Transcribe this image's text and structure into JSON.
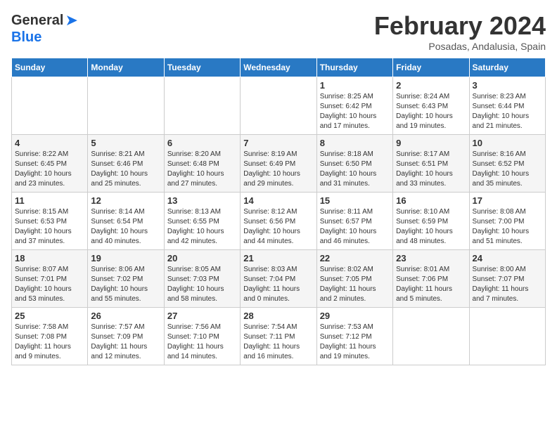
{
  "logo": {
    "general": "General",
    "blue": "Blue"
  },
  "title": "February 2024",
  "location": "Posadas, Andalusia, Spain",
  "days_of_week": [
    "Sunday",
    "Monday",
    "Tuesday",
    "Wednesday",
    "Thursday",
    "Friday",
    "Saturday"
  ],
  "weeks": [
    {
      "row_class": "",
      "days": [
        {
          "num": "",
          "info": ""
        },
        {
          "num": "",
          "info": ""
        },
        {
          "num": "",
          "info": ""
        },
        {
          "num": "",
          "info": ""
        },
        {
          "num": "1",
          "info": "Sunrise: 8:25 AM\nSunset: 6:42 PM\nDaylight: 10 hours\nand 17 minutes."
        },
        {
          "num": "2",
          "info": "Sunrise: 8:24 AM\nSunset: 6:43 PM\nDaylight: 10 hours\nand 19 minutes."
        },
        {
          "num": "3",
          "info": "Sunrise: 8:23 AM\nSunset: 6:44 PM\nDaylight: 10 hours\nand 21 minutes."
        }
      ]
    },
    {
      "row_class": "row-alt",
      "days": [
        {
          "num": "4",
          "info": "Sunrise: 8:22 AM\nSunset: 6:45 PM\nDaylight: 10 hours\nand 23 minutes."
        },
        {
          "num": "5",
          "info": "Sunrise: 8:21 AM\nSunset: 6:46 PM\nDaylight: 10 hours\nand 25 minutes."
        },
        {
          "num": "6",
          "info": "Sunrise: 8:20 AM\nSunset: 6:48 PM\nDaylight: 10 hours\nand 27 minutes."
        },
        {
          "num": "7",
          "info": "Sunrise: 8:19 AM\nSunset: 6:49 PM\nDaylight: 10 hours\nand 29 minutes."
        },
        {
          "num": "8",
          "info": "Sunrise: 8:18 AM\nSunset: 6:50 PM\nDaylight: 10 hours\nand 31 minutes."
        },
        {
          "num": "9",
          "info": "Sunrise: 8:17 AM\nSunset: 6:51 PM\nDaylight: 10 hours\nand 33 minutes."
        },
        {
          "num": "10",
          "info": "Sunrise: 8:16 AM\nSunset: 6:52 PM\nDaylight: 10 hours\nand 35 minutes."
        }
      ]
    },
    {
      "row_class": "",
      "days": [
        {
          "num": "11",
          "info": "Sunrise: 8:15 AM\nSunset: 6:53 PM\nDaylight: 10 hours\nand 37 minutes."
        },
        {
          "num": "12",
          "info": "Sunrise: 8:14 AM\nSunset: 6:54 PM\nDaylight: 10 hours\nand 40 minutes."
        },
        {
          "num": "13",
          "info": "Sunrise: 8:13 AM\nSunset: 6:55 PM\nDaylight: 10 hours\nand 42 minutes."
        },
        {
          "num": "14",
          "info": "Sunrise: 8:12 AM\nSunset: 6:56 PM\nDaylight: 10 hours\nand 44 minutes."
        },
        {
          "num": "15",
          "info": "Sunrise: 8:11 AM\nSunset: 6:57 PM\nDaylight: 10 hours\nand 46 minutes."
        },
        {
          "num": "16",
          "info": "Sunrise: 8:10 AM\nSunset: 6:59 PM\nDaylight: 10 hours\nand 48 minutes."
        },
        {
          "num": "17",
          "info": "Sunrise: 8:08 AM\nSunset: 7:00 PM\nDaylight: 10 hours\nand 51 minutes."
        }
      ]
    },
    {
      "row_class": "row-alt",
      "days": [
        {
          "num": "18",
          "info": "Sunrise: 8:07 AM\nSunset: 7:01 PM\nDaylight: 10 hours\nand 53 minutes."
        },
        {
          "num": "19",
          "info": "Sunrise: 8:06 AM\nSunset: 7:02 PM\nDaylight: 10 hours\nand 55 minutes."
        },
        {
          "num": "20",
          "info": "Sunrise: 8:05 AM\nSunset: 7:03 PM\nDaylight: 10 hours\nand 58 minutes."
        },
        {
          "num": "21",
          "info": "Sunrise: 8:03 AM\nSunset: 7:04 PM\nDaylight: 11 hours\nand 0 minutes."
        },
        {
          "num": "22",
          "info": "Sunrise: 8:02 AM\nSunset: 7:05 PM\nDaylight: 11 hours\nand 2 minutes."
        },
        {
          "num": "23",
          "info": "Sunrise: 8:01 AM\nSunset: 7:06 PM\nDaylight: 11 hours\nand 5 minutes."
        },
        {
          "num": "24",
          "info": "Sunrise: 8:00 AM\nSunset: 7:07 PM\nDaylight: 11 hours\nand 7 minutes."
        }
      ]
    },
    {
      "row_class": "",
      "days": [
        {
          "num": "25",
          "info": "Sunrise: 7:58 AM\nSunset: 7:08 PM\nDaylight: 11 hours\nand 9 minutes."
        },
        {
          "num": "26",
          "info": "Sunrise: 7:57 AM\nSunset: 7:09 PM\nDaylight: 11 hours\nand 12 minutes."
        },
        {
          "num": "27",
          "info": "Sunrise: 7:56 AM\nSunset: 7:10 PM\nDaylight: 11 hours\nand 14 minutes."
        },
        {
          "num": "28",
          "info": "Sunrise: 7:54 AM\nSunset: 7:11 PM\nDaylight: 11 hours\nand 16 minutes."
        },
        {
          "num": "29",
          "info": "Sunrise: 7:53 AM\nSunset: 7:12 PM\nDaylight: 11 hours\nand 19 minutes."
        },
        {
          "num": "",
          "info": ""
        },
        {
          "num": "",
          "info": ""
        }
      ]
    }
  ]
}
